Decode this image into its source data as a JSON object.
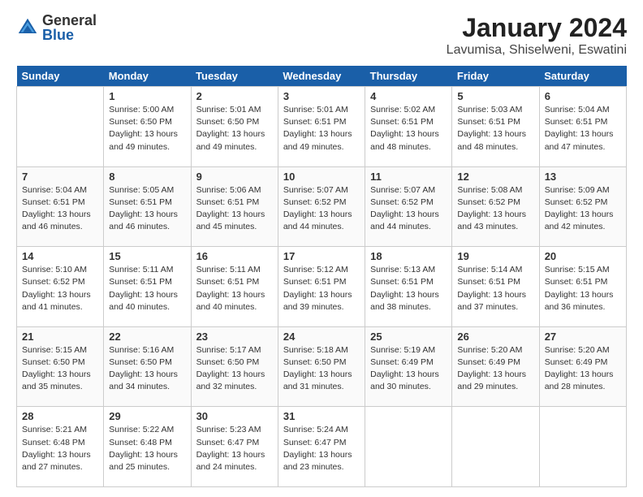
{
  "header": {
    "logo": {
      "general": "General",
      "blue": "Blue"
    },
    "title": "January 2024",
    "subtitle": "Lavumisa, Shiselweni, Eswatini"
  },
  "days_of_week": [
    "Sunday",
    "Monday",
    "Tuesday",
    "Wednesday",
    "Thursday",
    "Friday",
    "Saturday"
  ],
  "weeks": [
    [
      {
        "day": "",
        "info": ""
      },
      {
        "day": "1",
        "info": "Sunrise: 5:00 AM\nSunset: 6:50 PM\nDaylight: 13 hours\nand 49 minutes."
      },
      {
        "day": "2",
        "info": "Sunrise: 5:01 AM\nSunset: 6:50 PM\nDaylight: 13 hours\nand 49 minutes."
      },
      {
        "day": "3",
        "info": "Sunrise: 5:01 AM\nSunset: 6:51 PM\nDaylight: 13 hours\nand 49 minutes."
      },
      {
        "day": "4",
        "info": "Sunrise: 5:02 AM\nSunset: 6:51 PM\nDaylight: 13 hours\nand 48 minutes."
      },
      {
        "day": "5",
        "info": "Sunrise: 5:03 AM\nSunset: 6:51 PM\nDaylight: 13 hours\nand 48 minutes."
      },
      {
        "day": "6",
        "info": "Sunrise: 5:04 AM\nSunset: 6:51 PM\nDaylight: 13 hours\nand 47 minutes."
      }
    ],
    [
      {
        "day": "7",
        "info": "Sunrise: 5:04 AM\nSunset: 6:51 PM\nDaylight: 13 hours\nand 46 minutes."
      },
      {
        "day": "8",
        "info": "Sunrise: 5:05 AM\nSunset: 6:51 PM\nDaylight: 13 hours\nand 46 minutes."
      },
      {
        "day": "9",
        "info": "Sunrise: 5:06 AM\nSunset: 6:51 PM\nDaylight: 13 hours\nand 45 minutes."
      },
      {
        "day": "10",
        "info": "Sunrise: 5:07 AM\nSunset: 6:52 PM\nDaylight: 13 hours\nand 44 minutes."
      },
      {
        "day": "11",
        "info": "Sunrise: 5:07 AM\nSunset: 6:52 PM\nDaylight: 13 hours\nand 44 minutes."
      },
      {
        "day": "12",
        "info": "Sunrise: 5:08 AM\nSunset: 6:52 PM\nDaylight: 13 hours\nand 43 minutes."
      },
      {
        "day": "13",
        "info": "Sunrise: 5:09 AM\nSunset: 6:52 PM\nDaylight: 13 hours\nand 42 minutes."
      }
    ],
    [
      {
        "day": "14",
        "info": "Sunrise: 5:10 AM\nSunset: 6:52 PM\nDaylight: 13 hours\nand 41 minutes."
      },
      {
        "day": "15",
        "info": "Sunrise: 5:11 AM\nSunset: 6:51 PM\nDaylight: 13 hours\nand 40 minutes."
      },
      {
        "day": "16",
        "info": "Sunrise: 5:11 AM\nSunset: 6:51 PM\nDaylight: 13 hours\nand 40 minutes."
      },
      {
        "day": "17",
        "info": "Sunrise: 5:12 AM\nSunset: 6:51 PM\nDaylight: 13 hours\nand 39 minutes."
      },
      {
        "day": "18",
        "info": "Sunrise: 5:13 AM\nSunset: 6:51 PM\nDaylight: 13 hours\nand 38 minutes."
      },
      {
        "day": "19",
        "info": "Sunrise: 5:14 AM\nSunset: 6:51 PM\nDaylight: 13 hours\nand 37 minutes."
      },
      {
        "day": "20",
        "info": "Sunrise: 5:15 AM\nSunset: 6:51 PM\nDaylight: 13 hours\nand 36 minutes."
      }
    ],
    [
      {
        "day": "21",
        "info": "Sunrise: 5:15 AM\nSunset: 6:50 PM\nDaylight: 13 hours\nand 35 minutes."
      },
      {
        "day": "22",
        "info": "Sunrise: 5:16 AM\nSunset: 6:50 PM\nDaylight: 13 hours\nand 34 minutes."
      },
      {
        "day": "23",
        "info": "Sunrise: 5:17 AM\nSunset: 6:50 PM\nDaylight: 13 hours\nand 32 minutes."
      },
      {
        "day": "24",
        "info": "Sunrise: 5:18 AM\nSunset: 6:50 PM\nDaylight: 13 hours\nand 31 minutes."
      },
      {
        "day": "25",
        "info": "Sunrise: 5:19 AM\nSunset: 6:49 PM\nDaylight: 13 hours\nand 30 minutes."
      },
      {
        "day": "26",
        "info": "Sunrise: 5:20 AM\nSunset: 6:49 PM\nDaylight: 13 hours\nand 29 minutes."
      },
      {
        "day": "27",
        "info": "Sunrise: 5:20 AM\nSunset: 6:49 PM\nDaylight: 13 hours\nand 28 minutes."
      }
    ],
    [
      {
        "day": "28",
        "info": "Sunrise: 5:21 AM\nSunset: 6:48 PM\nDaylight: 13 hours\nand 27 minutes."
      },
      {
        "day": "29",
        "info": "Sunrise: 5:22 AM\nSunset: 6:48 PM\nDaylight: 13 hours\nand 25 minutes."
      },
      {
        "day": "30",
        "info": "Sunrise: 5:23 AM\nSunset: 6:47 PM\nDaylight: 13 hours\nand 24 minutes."
      },
      {
        "day": "31",
        "info": "Sunrise: 5:24 AM\nSunset: 6:47 PM\nDaylight: 13 hours\nand 23 minutes."
      },
      {
        "day": "",
        "info": ""
      },
      {
        "day": "",
        "info": ""
      },
      {
        "day": "",
        "info": ""
      }
    ]
  ]
}
